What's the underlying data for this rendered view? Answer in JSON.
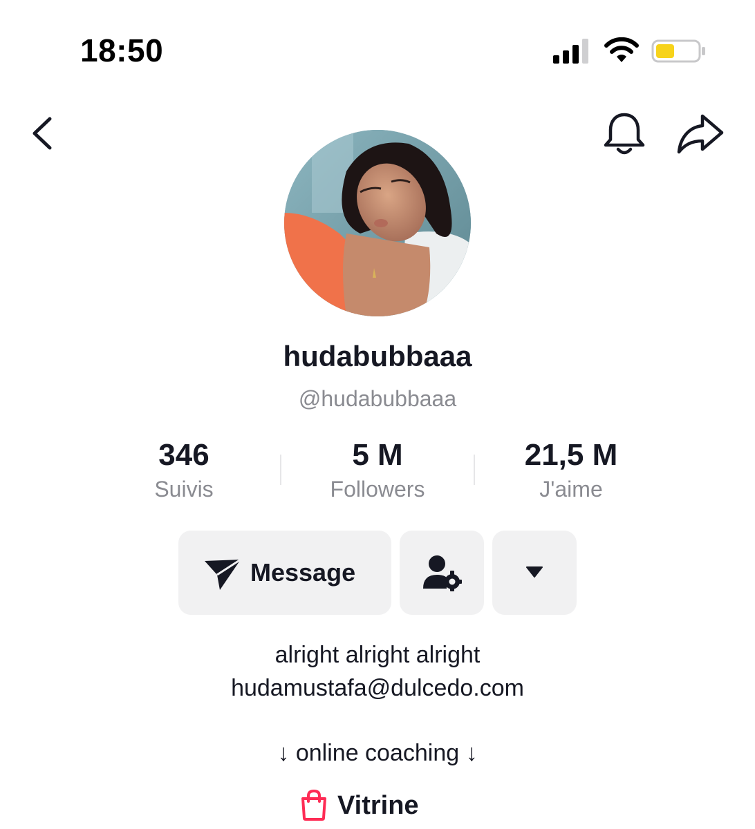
{
  "status_bar": {
    "time": "18:50",
    "battery_color": "#f7d31b"
  },
  "nav": {
    "back_icon": "chevron-left-icon",
    "notification_icon": "bell-icon",
    "share_icon": "share-arrow-icon"
  },
  "profile": {
    "display_name": "hudabubbaaa",
    "username": "@hudabubbaaa"
  },
  "stats": [
    {
      "value": "346",
      "label": "Suivis"
    },
    {
      "value": "5 M",
      "label": "Followers"
    },
    {
      "value": "21,5 M",
      "label": "J'aime"
    }
  ],
  "actions": {
    "message_label": "Message",
    "message_icon": "paper-plane-icon",
    "friend_settings_icon": "user-gear-icon",
    "more_icon": "caret-down-icon"
  },
  "bio": {
    "line1": "alright alright alright",
    "line2": "hudamustafa@dulcedo.com",
    "line3": "↓ online coaching ↓"
  },
  "vitrine": {
    "label": "Vitrine",
    "icon": "shopping-bag-icon",
    "icon_color": "#fe2c55"
  }
}
